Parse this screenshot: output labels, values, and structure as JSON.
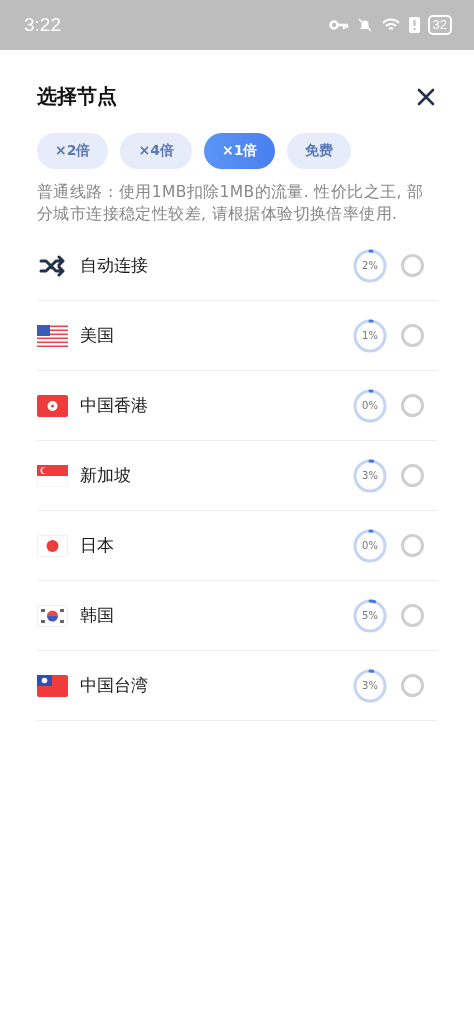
{
  "status_bar": {
    "time": "3:22",
    "battery": "32"
  },
  "title": "选择节点",
  "chips": [
    {
      "label": "×2倍",
      "selected": false
    },
    {
      "label": "×4倍",
      "selected": false
    },
    {
      "label": "×1倍",
      "selected": true
    },
    {
      "label": "免费",
      "selected": false
    }
  ],
  "description": "普通线路 : 使用1MB扣除1MB的流量. 性价比之王, 部分城市连接稳定性较差, 请根据体验切换倍率使用.",
  "nodes": [
    {
      "kind": "shuffle",
      "name": "自动连接",
      "load": "2%",
      "level": 0.02,
      "selected": false
    },
    {
      "kind": "us",
      "name": "美国",
      "load": "1%",
      "level": 0.01,
      "selected": false
    },
    {
      "kind": "hk",
      "name": "中国香港",
      "load": "0%",
      "level": 0.01,
      "selected": false
    },
    {
      "kind": "sg",
      "name": "新加坡",
      "load": "3%",
      "level": 0.03,
      "selected": false
    },
    {
      "kind": "jp",
      "name": "日本",
      "load": "0%",
      "level": 0.01,
      "selected": false
    },
    {
      "kind": "kr",
      "name": "韩国",
      "load": "5%",
      "level": 0.05,
      "selected": false
    },
    {
      "kind": "tw",
      "name": "中国台湾",
      "load": "3%",
      "level": 0.03,
      "selected": false
    }
  ]
}
